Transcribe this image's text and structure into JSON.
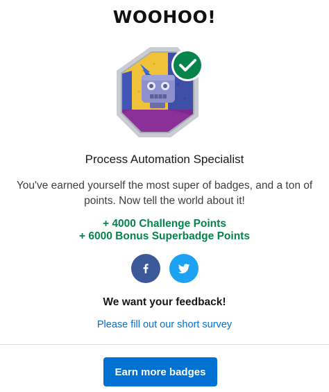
{
  "modal": {
    "title": "WOOHOO!",
    "badge": {
      "name": "Process Automation Specialist",
      "icon": "robot-badge-icon",
      "status_icon": "checkmark-icon"
    },
    "message": "You've earned yourself the most super of badges, and a ton of points. Now tell the world about it!",
    "points": [
      "+ 4000 Challenge Points",
      "+ 6000 Bonus Superbadge Points"
    ],
    "share": {
      "facebook_icon": "facebook-icon",
      "twitter_icon": "twitter-icon"
    },
    "feedback_title": "We want your feedback!",
    "survey_link": "Please fill out our short survey",
    "primary_button": "Earn more badges"
  },
  "colors": {
    "points_green": "#04844b",
    "link_blue": "#0070d2",
    "facebook_blue": "#3b5998",
    "twitter_blue": "#1da1f2",
    "check_green": "#04844b"
  }
}
